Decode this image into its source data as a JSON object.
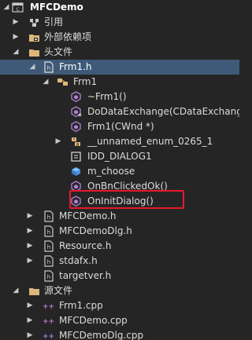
{
  "colors": {
    "background": "#252526",
    "selected_row": "#3e5a78",
    "highlight_border": "#e8192c",
    "folder": "#dcb67a",
    "method": "#b180d7",
    "header_file": "#3c78c3",
    "cpp_file": "#9b4f96"
  },
  "tree": {
    "project": {
      "label": "MFCDemo",
      "icon": "project-icon",
      "expanded": true
    },
    "references": {
      "label": "引用",
      "icon": "references-icon",
      "expanded": false
    },
    "external_deps": {
      "label": "外部依赖项",
      "icon": "external-deps-icon",
      "expanded": false
    },
    "header_folder": {
      "label": "头文件",
      "icon": "folder-icon",
      "expanded": true
    },
    "frm1_h": {
      "label": "Frm1.h",
      "icon": "header-file-icon",
      "expanded": true,
      "selected": true
    },
    "frm1_class": {
      "label": "Frm1",
      "icon": "class-icon",
      "expanded": true
    },
    "members": [
      {
        "label": "~Frm1()",
        "icon": "method-icon"
      },
      {
        "label": "DoDataExchange(CDataExchange",
        "icon": "protected-method-icon"
      },
      {
        "label": "Frm1(CWnd *)",
        "icon": "method-icon"
      },
      {
        "label": "__unnamed_enum_0265_1",
        "icon": "enum-icon",
        "expandable": true
      },
      {
        "label": "IDD_DIALOG1",
        "icon": "enum-member-icon"
      },
      {
        "label": "m_choose",
        "icon": "field-icon"
      },
      {
        "label": "OnBnClickedOk()",
        "icon": "method-icon"
      },
      {
        "label": "OnInitDialog()",
        "icon": "method-icon",
        "highlighted": true
      }
    ],
    "header_files": [
      {
        "label": "MFCDemo.h",
        "icon": "header-file-icon"
      },
      {
        "label": "MFCDemoDlg.h",
        "icon": "header-file-icon"
      },
      {
        "label": "Resource.h",
        "icon": "header-file-icon"
      },
      {
        "label": "stdafx.h",
        "icon": "header-file-icon"
      },
      {
        "label": "targetver.h",
        "icon": "header-file-icon"
      }
    ],
    "source_folder": {
      "label": "源文件",
      "icon": "folder-icon",
      "expanded": true
    },
    "source_files": [
      {
        "label": "Frm1.cpp",
        "icon": "cpp-file-icon"
      },
      {
        "label": "MFCDemo.cpp",
        "icon": "cpp-file-icon"
      },
      {
        "label": "MFCDemoDlg.cpp",
        "icon": "cpp-file-icon"
      }
    ]
  }
}
